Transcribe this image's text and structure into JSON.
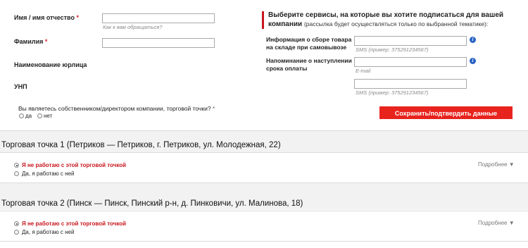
{
  "form": {
    "first_name": {
      "label": "Имя / имя отчество",
      "required_mark": "*",
      "hint": "Как к вам обращаться?"
    },
    "last_name": {
      "label": "Фамилия",
      "required_mark": "*"
    },
    "company": {
      "label": "Наименование юрлица"
    },
    "unp": {
      "label": "УНП"
    },
    "owner_question": {
      "label": "Вы являетесь собственником/директором компании, торговой точки?",
      "required_mark": "*"
    },
    "owner_options": [
      "да",
      "нет"
    ]
  },
  "services": {
    "title": "Выберите сервисы, на которые вы хотите подписаться для вашей компании",
    "subtitle": "(рассылка будет осуществляться только по выбранной тематике):",
    "items": [
      {
        "label": "Информация о сборе товара на складе при самовывозе",
        "hint": "SMS (пример: 375291234567)"
      },
      {
        "label": "Напоминание о наступлении срока оплаты",
        "hint": "E-mail"
      },
      {
        "label": "",
        "hint": "SMS (пример: 375291234567)"
      }
    ]
  },
  "save_button": "Сохранить/подтвердить данные",
  "points": [
    {
      "title": "Торговая точка 1 (Петриков — Петриков, г. Петриков, ул. Молодежная, 22)",
      "option_no": "Я не работаю с этой торговой точкой",
      "option_yes": "Да, я работаю с ней",
      "more": "Подробнее ▼"
    },
    {
      "title": "Торговая точка 2 (Пинск — Пинск, Пинский р-н, д. Пинковичи, ул. Малинова, 18)",
      "option_no": "Я не работаю с этой торговой точкой",
      "option_yes": "Да, я работаю с ней",
      "more": "Подробнее ▼"
    }
  ],
  "colors": {
    "accent_red": "#e8231e",
    "info_blue": "#2a63c4"
  }
}
